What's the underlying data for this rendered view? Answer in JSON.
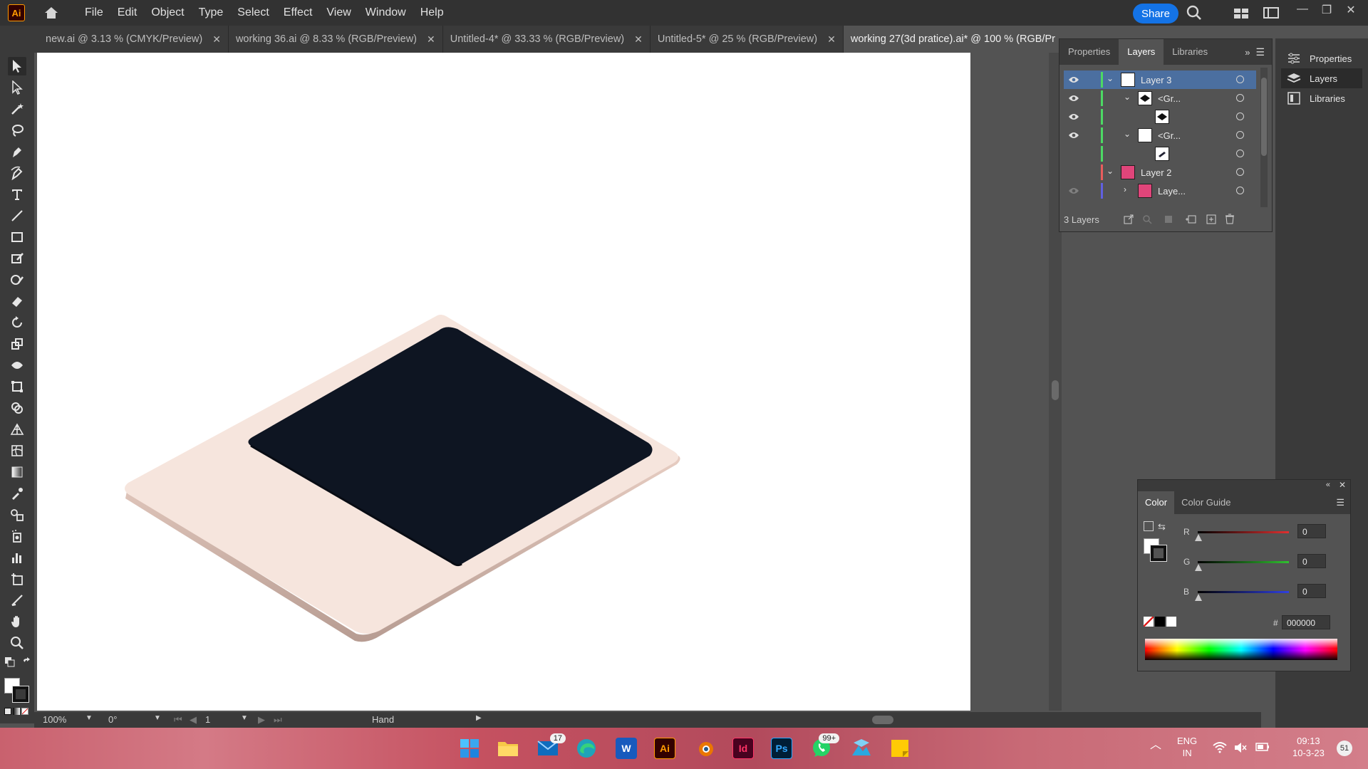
{
  "app": {
    "logo_text": "Ai",
    "share_label": "Share"
  },
  "menu": [
    "File",
    "Edit",
    "Object",
    "Type",
    "Select",
    "Effect",
    "View",
    "Window",
    "Help"
  ],
  "tabs": [
    {
      "label": "new.ai @ 3.13 % (CMYK/Preview)",
      "active": false
    },
    {
      "label": "working 36.ai @ 8.33 % (RGB/Preview)",
      "active": false
    },
    {
      "label": "Untitled-4* @ 33.33 % (RGB/Preview)",
      "active": false
    },
    {
      "label": "Untitled-5* @ 25 % (RGB/Preview)",
      "active": false
    },
    {
      "label": "working 27(3d pratice).ai* @ 100 % (RGB/Pr",
      "active": true
    }
  ],
  "layers_panel": {
    "tabs": [
      "Properties",
      "Layers",
      "Libraries"
    ],
    "active_tab": "Layers",
    "rows": [
      {
        "name": "Layer 3",
        "visible": true,
        "color": "#4cd964"
      },
      {
        "name": "<Gr...",
        "visible": true,
        "color": "#4cd964"
      },
      {
        "name": "",
        "visible": true,
        "color": "#4cd964"
      },
      {
        "name": "<Gr...",
        "visible": true,
        "color": "#4cd964"
      },
      {
        "name": "",
        "visible": false,
        "color": "#4cd964"
      },
      {
        "name": "Layer 2",
        "visible": false,
        "color": "#e85d5d"
      },
      {
        "name": "Laye...",
        "visible": true,
        "color": "#6060e0"
      }
    ],
    "footer": "3 Layers"
  },
  "dock": [
    "Properties",
    "Layers",
    "Libraries"
  ],
  "color_panel": {
    "tabs": [
      "Color",
      "Color Guide"
    ],
    "channels": [
      {
        "label": "R",
        "value": "0",
        "color": "#e03030"
      },
      {
        "label": "G",
        "value": "0",
        "color": "#30c030"
      },
      {
        "label": "B",
        "value": "0",
        "color": "#3040e0"
      }
    ],
    "hex_label": "#",
    "hex": "000000"
  },
  "status": {
    "zoom": "100%",
    "rotate": "0°",
    "artboard": "1",
    "tool": "Hand"
  },
  "taskbar": {
    "mail_badge": "17",
    "whatsapp_badge": "99+",
    "lang_top": "ENG",
    "lang_bottom": "IN",
    "time": "09:13",
    "date": "10-3-23",
    "notifications": "51",
    "apps": {
      "ai": "Ai",
      "id": "Id",
      "ps": "Ps",
      "word": "W"
    }
  },
  "colors": {
    "artwork_base": "#f5e4dc",
    "artwork_face": "#0f1623",
    "accent": "#1473e6"
  }
}
